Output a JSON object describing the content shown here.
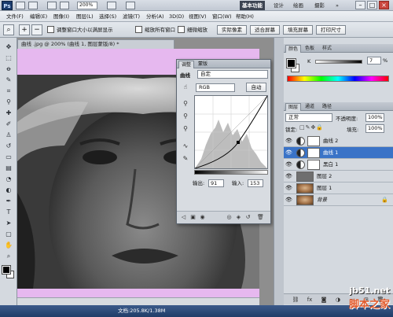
{
  "appbar": {
    "logo": "Ps",
    "zoom": "200%",
    "workspaces": [
      "基本功能",
      "设计",
      "绘画",
      "摄影"
    ],
    "more": "»",
    "window_buttons": [
      "–",
      "□",
      "×"
    ]
  },
  "menubar": {
    "items": [
      "文件(F)",
      "编辑(E)",
      "图像(I)",
      "图层(L)",
      "选择(S)",
      "滤镜(T)",
      "分析(A)",
      "3D(D)",
      "视图(V)",
      "窗口(W)",
      "帮助(H)"
    ]
  },
  "options": {
    "resize_windows": "调整窗口大小以满屏显示",
    "zoom_all": "缩放所有窗口",
    "scrubby_zoom": "细微缩放",
    "actual_pixels": "实际像素",
    "fit_screen": "适合屏幕",
    "fill_screen": "填充屏幕",
    "print_size": "打印尺寸"
  },
  "document": {
    "tab_title": "曲线 .jpg @ 200% (曲线 1, 图层蒙版/8) *",
    "status": "文档:205.8K/1.38M"
  },
  "curves_panel": {
    "tabs": [
      "调整",
      "蒙版"
    ],
    "title": "曲线",
    "preset": "自定",
    "channel": "RGB",
    "auto_button": "自动",
    "output_label": "输出:",
    "output_value": "91",
    "input_label": "输入:",
    "input_value": "153"
  },
  "color_panel": {
    "tabs": [
      "颜色",
      "色板",
      "样式"
    ],
    "channel_label": "K",
    "value": "7",
    "unit": "%"
  },
  "layers_panel": {
    "tabs": [
      "图层",
      "通道",
      "路径"
    ],
    "blend_mode": "正常",
    "opacity_label": "不透明度:",
    "opacity_value": "100%",
    "lock_label": "锁定:",
    "fill_label": "填充:",
    "fill_value": "100%",
    "layers": [
      {
        "name": "曲线 2",
        "type": "adjustment",
        "selected": false
      },
      {
        "name": "曲线 1",
        "type": "adjustment",
        "selected": true
      },
      {
        "name": "黑白 1",
        "type": "adjustment",
        "selected": false
      },
      {
        "name": "图层 2",
        "type": "gray",
        "selected": false
      },
      {
        "name": "图层 1",
        "type": "photo",
        "selected": false
      },
      {
        "name": "背景",
        "type": "photo",
        "selected": false
      }
    ]
  },
  "watermark": {
    "domain": "jb51.net",
    "cn": "脚本之家"
  },
  "colors": {
    "canvas_background": "#e6b8ef",
    "selected_layer": "#3a73c7",
    "active_workspace": "#3c4452"
  }
}
